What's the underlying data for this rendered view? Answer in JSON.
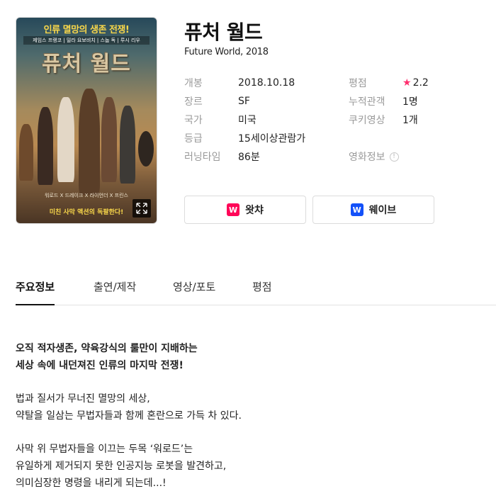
{
  "poster": {
    "tagline": "인류 멸망의 생존 전쟁!",
    "cast_top": "제임스 프랭코 | 밀라 요보비치 | 스눕 독 | 루시 리우",
    "poster_title": "퓨처 월드",
    "cast_bottom": "워로드 X 드레이크 X 라이언더 X 프린스",
    "bottom_tag": "미친 사막 액션의 독팔한다!",
    "expand_icon": "expand-icon"
  },
  "movie": {
    "title": "퓨처 월드",
    "subtitle": "Future World, 2018"
  },
  "info_left": [
    {
      "label": "개봉",
      "value": "2018.10.18"
    },
    {
      "label": "장르",
      "value": "SF"
    },
    {
      "label": "국가",
      "value": "미국"
    },
    {
      "label": "등급",
      "value": "15세이상관람가"
    },
    {
      "label": "러닝타임",
      "value": "86분"
    }
  ],
  "info_right": [
    {
      "label": "평점",
      "value": "2.2",
      "icon": "star-icon"
    },
    {
      "label": "누적관객",
      "value": "1명"
    },
    {
      "label": "쿠키영상",
      "value": "1개"
    },
    {
      "label": "",
      "value": ""
    },
    {
      "label": "영화정보",
      "value": "",
      "icon": "info-icon"
    }
  ],
  "services": {
    "watcha": {
      "label": "왓챠",
      "logo_letter": "W",
      "color": "#ff0558"
    },
    "wavve": {
      "label": "웨이브",
      "logo_letter": "W",
      "color": "#1351f9"
    }
  },
  "tabs": [
    "주요정보",
    "출연/제작",
    "영상/포토",
    "평점"
  ],
  "synopsis": {
    "lead": [
      "오직 적자생존, 약육강식의 룰만이 지배하는",
      "세상 속에 내던져진 인류의 마지막 전쟁!"
    ],
    "para2": [
      "법과 질서가 무너진 멸망의 세상,",
      "약탈을 일삼는 무법자들과 함께 혼란으로 가득 차 있다."
    ],
    "para3": [
      "사막 위 무법자들을 이끄는 두목 ‘워로드’는",
      "유일하게 제거되지 못한 인공지능 로봇을 발견하고,",
      "의미심장한 명령을 내리게 되는데...!"
    ]
  },
  "colors": {
    "star": "#ff2f6e",
    "tab_underline": "#111111",
    "label_gray": "#9a9a9a"
  }
}
